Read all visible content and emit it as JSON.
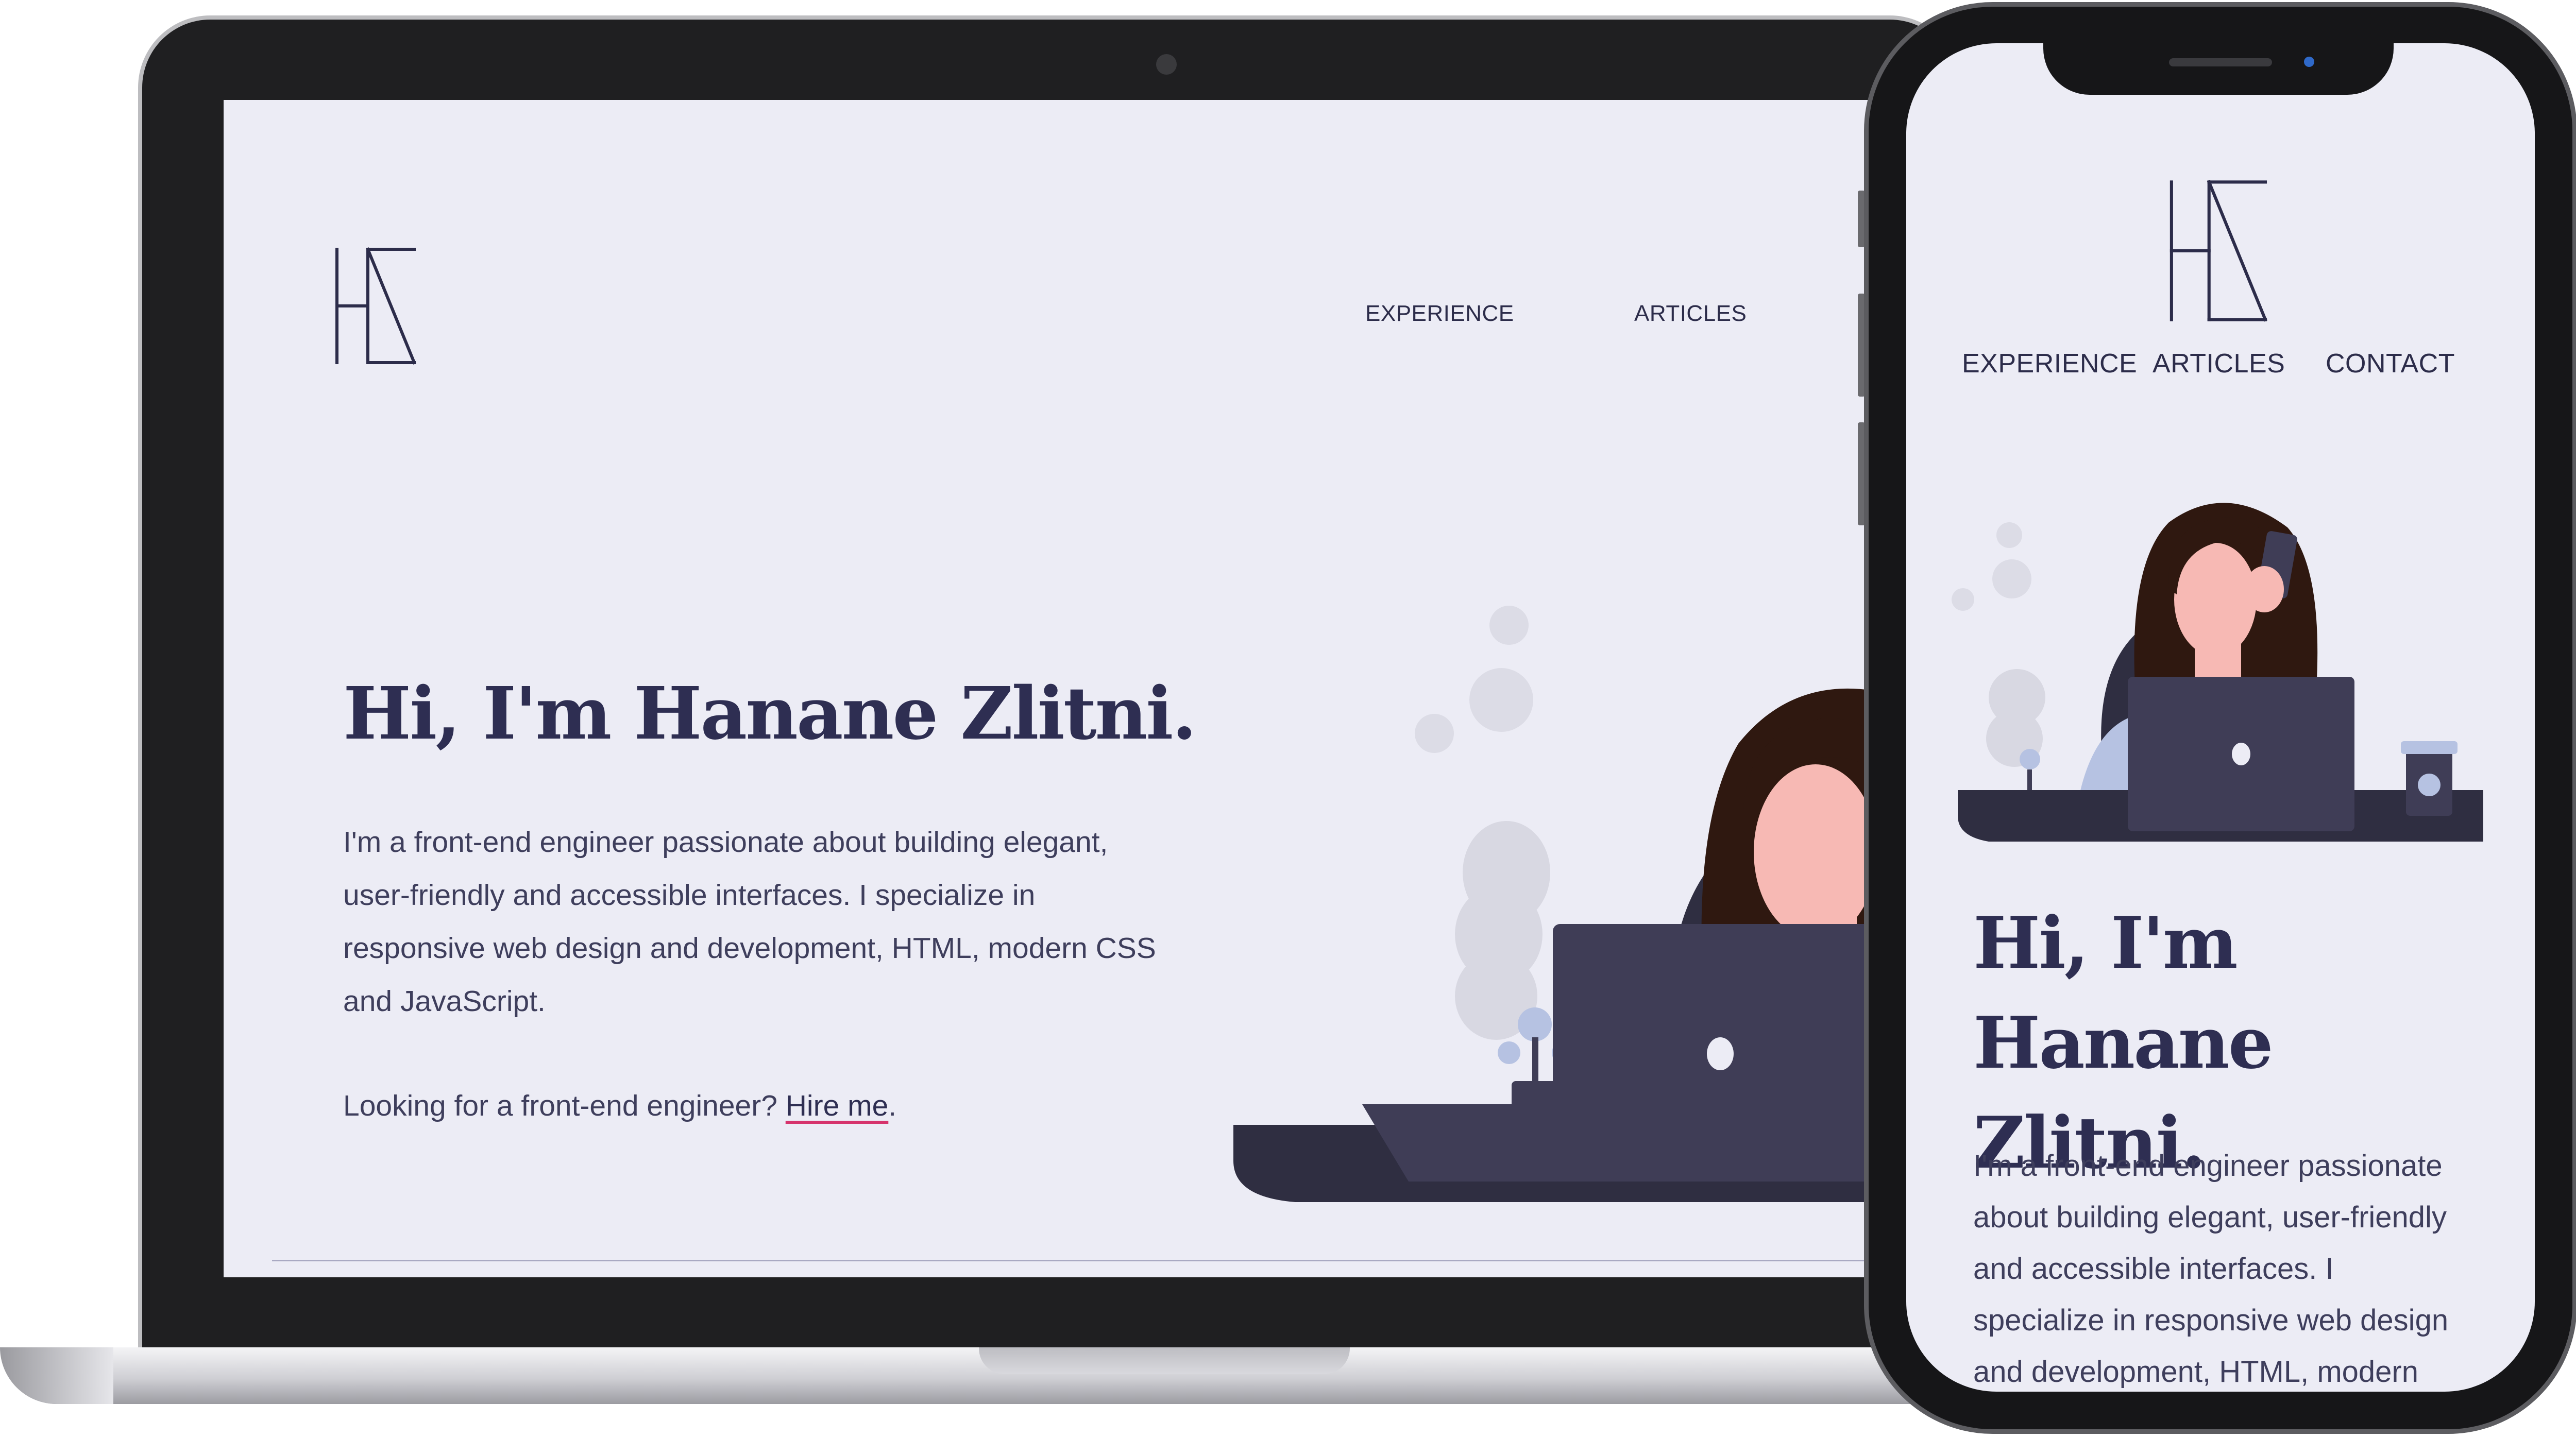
{
  "logo": {
    "monogram": "HZ"
  },
  "nav": {
    "experience": "EXPERIENCE",
    "articles": "ARTICLES",
    "contact": "CONTACT"
  },
  "hero": {
    "title": "Hi, I'm Hanane Zlitni.",
    "title_line1": "Hi, I'm",
    "title_line2": "Hanane Zlitni.",
    "bio_lines": [
      "I'm a front-end engineer passionate about building elegant,",
      "user-friendly and accessible interfaces. I specialize in",
      "responsive web design and development, HTML, modern CSS",
      "and JavaScript."
    ],
    "phone_bio_lines": [
      "I'm a front-end engineer passionate",
      "about building elegant, user-friendly",
      "and accessible interfaces. I",
      "specialize in responsive web design",
      "and development, HTML, modern"
    ],
    "hire_prefix": "Looking for a front-end engineer? ",
    "hire_link": "Hire me",
    "hire_suffix": "."
  },
  "colors": {
    "background": "#ececf5",
    "heading": "#2e2e52",
    "body_text": "#3e3e5c",
    "link_underline": "#d6336c",
    "desk": "#3f3d56",
    "hair": "#2f1810",
    "skin": "#f7b9b4",
    "sweater": "#b6c2e2"
  },
  "icons": {
    "logo": "hz-monogram-icon",
    "illustration": "woman-at-laptop-illustration"
  }
}
